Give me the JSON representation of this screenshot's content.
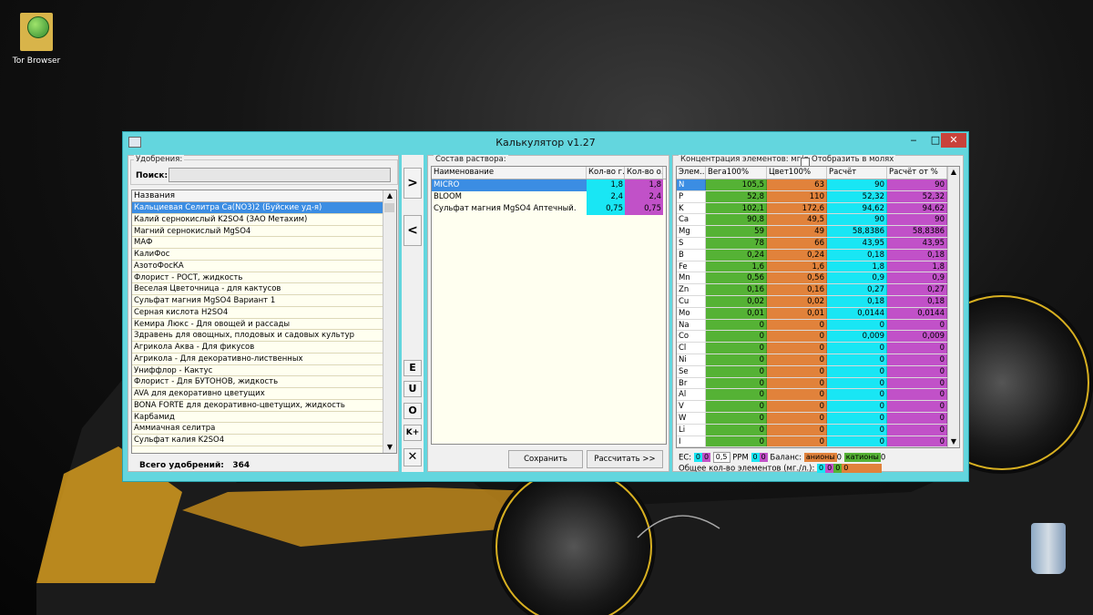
{
  "desktop": {
    "tor_label": "Tor Browser"
  },
  "window": {
    "title": "Калькулятор v1.27",
    "minimize": "‒",
    "maximize": "□",
    "close": "✕"
  },
  "left": {
    "group": "Удобрения:",
    "search_label": "Поиск:",
    "search_value": "",
    "column": "Названия",
    "items": [
      "Кальциевая Селитра Ca(NO3)2 (Буйские уд-я)",
      "Калий  сернокислый  K2SO4 (ЗАО Метахим)",
      "Магний сернокислый MgSO4",
      "МАФ",
      "КалиФос",
      "АзотоФосКА",
      "Флорист - РОСТ, жидкость",
      "Веселая Цветочница - для кактусов",
      "Сульфат магния MgSO4 Вариант 1",
      "Серная кислота H2SO4",
      "Кемира Люкс - Для овощей и рассады",
      "Здравень для овощных, плодовых и садовых культур",
      "Агрикола Аква - Для фикусов",
      "Агрикола - Для декоративно-лиственных",
      "Униффлор - Кактус",
      "Флорист - Для БУТОНОВ, жидкость",
      "AVA для декоративно цветущих",
      "BONA FORTE для декоративно-цветущих, жидкость",
      "Карбамид",
      "Аммиачная селитра",
      "Сульфат калия K2SO4"
    ],
    "total_label": "Всего удобрений:",
    "total_value": "364"
  },
  "buttons": {
    "add": ">",
    "remove": "<",
    "e": "E",
    "u": "U",
    "o": "O",
    "kplus": "K+",
    "x": "✕"
  },
  "center": {
    "group": "Состав раствора:",
    "columns": [
      "Наименование",
      "Кол-во г...",
      "Кол-во о..."
    ],
    "rows": [
      {
        "name": "MICRO",
        "q1": "1,8",
        "q2": "1,8"
      },
      {
        "name": "BLOOM",
        "q1": "2,4",
        "q2": "2,4"
      },
      {
        "name": "Сульфат магния MgSO4 Аптечный.",
        "q1": "0,75",
        "q2": "0,75"
      }
    ],
    "save": "Сохранить",
    "calc": "Рассчитать >>"
  },
  "right": {
    "group": "Концентрация элементов: мг/л.",
    "moles_label": "Отобразить в молях",
    "columns": [
      "Элем...",
      "Вега100%",
      "Цвет100%",
      "Расчёт",
      "Расчёт от %"
    ],
    "rows": [
      [
        "N",
        "105,5",
        "63",
        "90",
        "90"
      ],
      [
        "P",
        "52,8",
        "110",
        "52,32",
        "52,32"
      ],
      [
        "K",
        "102,1",
        "172,6",
        "94,62",
        "94,62"
      ],
      [
        "Ca",
        "90,8",
        "49,5",
        "90",
        "90"
      ],
      [
        "Mg",
        "59",
        "49",
        "58,8386",
        "58,8386"
      ],
      [
        "S",
        "78",
        "66",
        "43,95",
        "43,95"
      ],
      [
        "B",
        "0,24",
        "0,24",
        "0,18",
        "0,18"
      ],
      [
        "Fe",
        "1,6",
        "1,6",
        "1,8",
        "1,8"
      ],
      [
        "Mn",
        "0,56",
        "0,56",
        "0,9",
        "0,9"
      ],
      [
        "Zn",
        "0,16",
        "0,16",
        "0,27",
        "0,27"
      ],
      [
        "Cu",
        "0,02",
        "0,02",
        "0,18",
        "0,18"
      ],
      [
        "Mo",
        "0,01",
        "0,01",
        "0,0144",
        "0,0144"
      ],
      [
        "Na",
        "0",
        "0",
        "0",
        "0"
      ],
      [
        "Co",
        "0",
        "0",
        "0,009",
        "0,009"
      ],
      [
        "Cl",
        "0",
        "0",
        "0",
        "0"
      ],
      [
        "Ni",
        "0",
        "0",
        "0",
        "0"
      ],
      [
        "Se",
        "0",
        "0",
        "0",
        "0"
      ],
      [
        "Br",
        "0",
        "0",
        "0",
        "0"
      ],
      [
        "Al",
        "0",
        "0",
        "0",
        "0"
      ],
      [
        "V",
        "0",
        "0",
        "0",
        "0"
      ],
      [
        "W",
        "0",
        "0",
        "0",
        "0"
      ],
      [
        "Li",
        "0",
        "0",
        "0",
        "0"
      ],
      [
        "I",
        "0",
        "0",
        "0",
        "0"
      ]
    ],
    "ec_label": "EC:",
    "ec_v1": "0",
    "ec_v2": "0",
    "ec_factor": "0,5",
    "ppm_label": "PPM",
    "ppm_v1": "0",
    "ppm_v2": "0",
    "balance_label": "Баланс:",
    "anions_label": "анионы",
    "anions_value": "0",
    "cations_label": "катионы",
    "cations_value": "0",
    "total_label": "Общее кол-во элементов (мг./л.):",
    "totals": [
      "0",
      "0",
      "0",
      "0"
    ]
  },
  "colors": {
    "window_frame": "#63d6de",
    "col_vega": "#55b235",
    "col_tsvet": "#e1823b",
    "col_calc": "#19e6f4",
    "col_calc_pct": "#c151c8",
    "selection": "#3b8de3",
    "list_bg": "#fffff0"
  }
}
